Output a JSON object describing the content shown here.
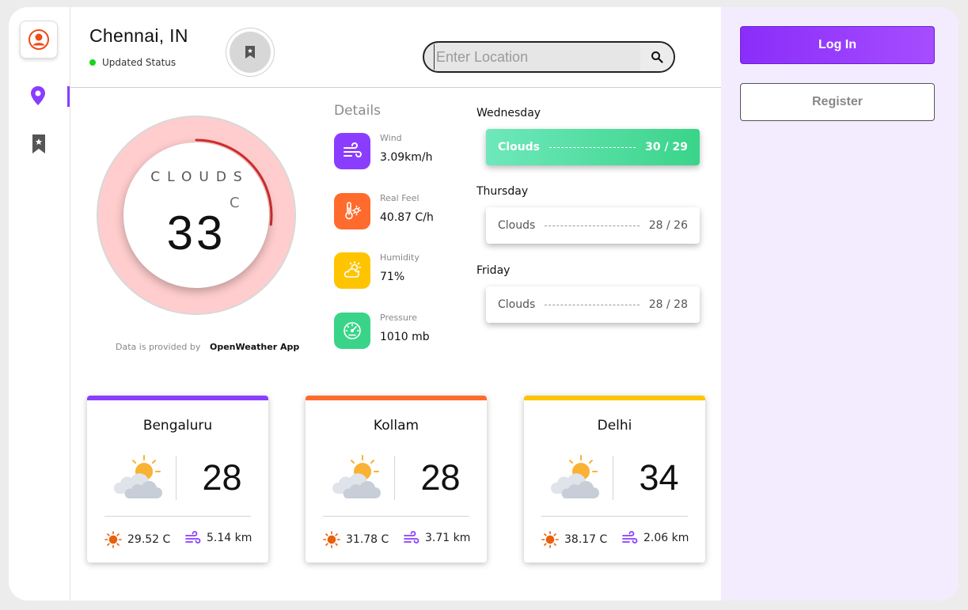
{
  "header": {
    "city": "Chennai, IN",
    "status": "Updated Status",
    "search_placeholder": "Enter Location"
  },
  "current": {
    "condition": "CLOUDS",
    "unit": "C",
    "temperature": "33",
    "gauge_fraction": 0.27
  },
  "credit": {
    "prefix": "Data is provided by",
    "source": "OpenWeather App"
  },
  "details": {
    "title": "Details",
    "items": [
      {
        "label": "Wind",
        "value": "3.09km/h",
        "icon": "wind-icon",
        "color": "#8b3dff"
      },
      {
        "label": "Real Feel",
        "value": "40.87 C/h",
        "icon": "thermometer-sun-icon",
        "color": "#ff6b2c"
      },
      {
        "label": "Humidity",
        "value": "71%",
        "icon": "sun-cloud-icon",
        "color": "#ffc400"
      },
      {
        "label": "Pressure",
        "value": "1010 mb",
        "icon": "gauge-icon",
        "color": "#3ad489"
      }
    ]
  },
  "forecast": [
    {
      "day": "Wednesday",
      "condition": "Clouds",
      "temps": "30 / 29",
      "highlight": true
    },
    {
      "day": "Thursday",
      "condition": "Clouds",
      "temps": "28 / 26",
      "highlight": false
    },
    {
      "day": "Friday",
      "condition": "Clouds",
      "temps": "28 / 28",
      "highlight": false
    }
  ],
  "cities": [
    {
      "name": "Bengaluru",
      "temp": "28",
      "feel": "29.52 C",
      "wind": "5.14 km",
      "accent": "#8b3dff"
    },
    {
      "name": "Kollam",
      "temp": "28",
      "feel": "31.78 C",
      "wind": "3.71 km",
      "accent": "#ff6b2c"
    },
    {
      "name": "Delhi",
      "temp": "34",
      "feel": "38.17 C",
      "wind": "2.06 km",
      "accent": "#ffc400"
    }
  ],
  "auth": {
    "login": "Log In",
    "register": "Register"
  },
  "colors": {
    "accent": "#8b3dff",
    "gauge_arc": "#d32f2f",
    "gauge_track": "#ffcdcd",
    "status_dot": "#17d41d"
  }
}
